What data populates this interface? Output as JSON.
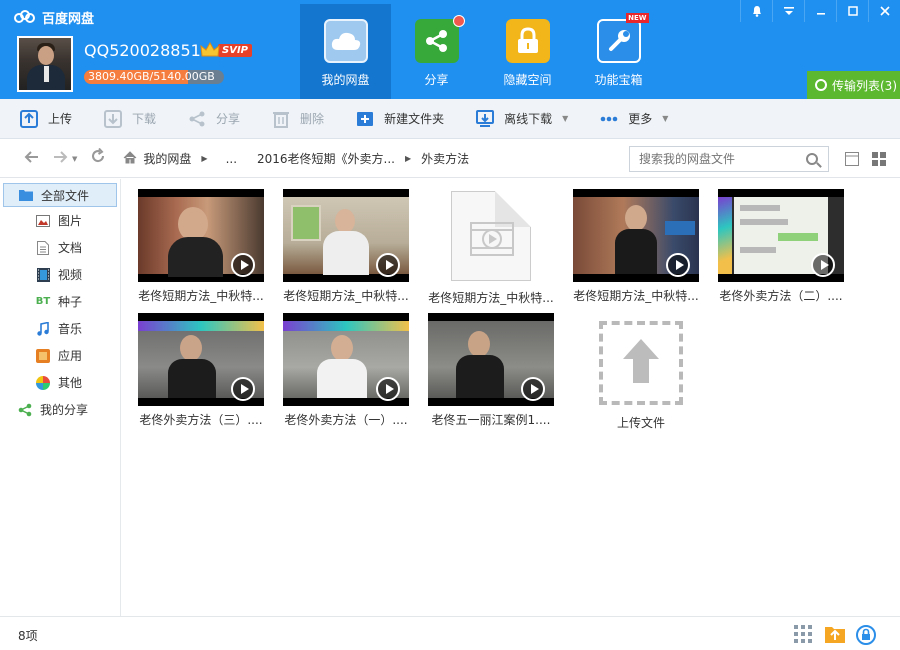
{
  "app": {
    "title": "百度网盘"
  },
  "user": {
    "name": "QQ520028851",
    "vip_label": "SVIP",
    "quota_text": "3809.40GB/5140.00GB",
    "quota_used_fraction": 0.741
  },
  "nav_tabs": [
    {
      "label": "我的网盘",
      "icon": "cloud-icon",
      "active": true
    },
    {
      "label": "分享",
      "icon": "share-icon",
      "badge_dot": true
    },
    {
      "label": "隐藏空间",
      "icon": "lock-icon"
    },
    {
      "label": "功能宝箱",
      "icon": "tools-icon",
      "tag": "NEW"
    }
  ],
  "transfer": {
    "label": "传输列表(3)"
  },
  "toolbar": {
    "upload": "上传",
    "download": "下载",
    "share": "分享",
    "delete": "删除",
    "new_folder": "新建文件夹",
    "offline_download": "离线下载",
    "more": "更多"
  },
  "breadcrumb": {
    "root": "我的网盘",
    "ellipsis": "...",
    "parent": "2016老佟短期《外卖方...",
    "current": "外卖方法"
  },
  "search": {
    "placeholder": "搜索我的网盘文件"
  },
  "sidebar": {
    "items": [
      {
        "label": "全部文件",
        "icon": "folder-icon"
      },
      {
        "label": "图片",
        "icon": "image-icon"
      },
      {
        "label": "文档",
        "icon": "document-icon"
      },
      {
        "label": "视频",
        "icon": "video-icon"
      },
      {
        "label": "种子",
        "icon": "bt-icon",
        "icon_text": "BT"
      },
      {
        "label": "音乐",
        "icon": "music-icon"
      },
      {
        "label": "应用",
        "icon": "app-icon"
      },
      {
        "label": "其他",
        "icon": "other-icon"
      },
      {
        "label": "我的分享",
        "icon": "share-icon"
      }
    ]
  },
  "files": [
    {
      "name": "老佟短期方法_中秋特...",
      "type": "video"
    },
    {
      "name": "老佟短期方法_中秋特...",
      "type": "video"
    },
    {
      "name": "老佟短期方法_中秋特...",
      "type": "video-placeholder"
    },
    {
      "name": "老佟短期方法_中秋特...",
      "type": "video"
    },
    {
      "name": "老佟外卖方法（二）....",
      "type": "video"
    },
    {
      "name": "老佟外卖方法（三）....",
      "type": "video"
    },
    {
      "name": "老佟外卖方法（一）....",
      "type": "video"
    },
    {
      "name": "老佟五一丽江案例1....",
      "type": "video"
    }
  ],
  "upload_tile": {
    "label": "上传文件"
  },
  "status": {
    "count": "8项"
  },
  "colors": {
    "header": "#1f8ff0",
    "active_tab": "#1576cf",
    "transfer": "#5cb82f",
    "vip": "#e8412a"
  }
}
